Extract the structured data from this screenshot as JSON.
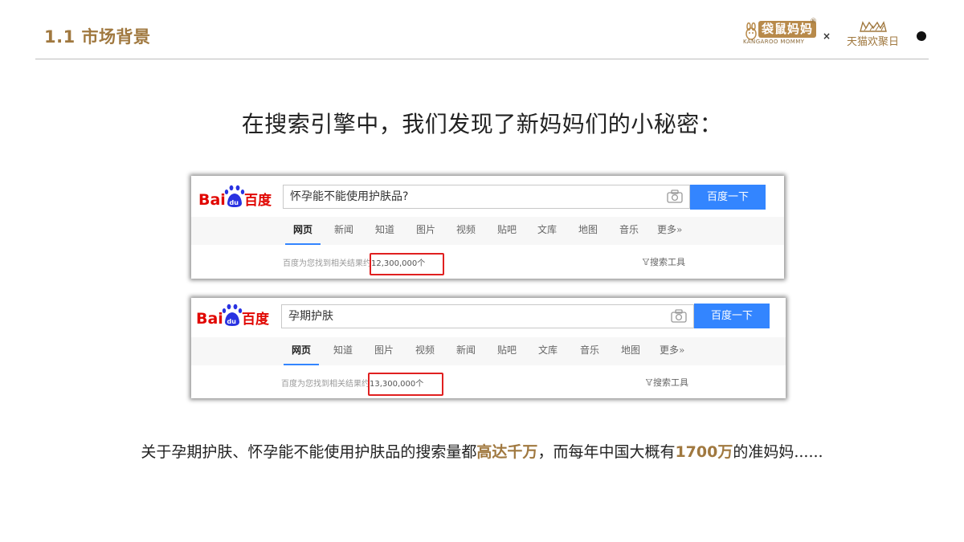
{
  "header": {
    "section_title": "1.1 市场背景",
    "brand_left_cn": "袋鼠妈妈",
    "brand_left_en": "KANGAROO MOMMY",
    "brand_left_reg": "®",
    "separator": "×",
    "brand_right": "天猫欢聚日"
  },
  "headline": "在搜索引擎中，我们发现了新妈妈们的小秘密：",
  "search_1": {
    "query": "怀孕能不能使用护肤品?",
    "button_label": "百度一下",
    "tabs": [
      "网页",
      "新闻",
      "知道",
      "图片",
      "视频",
      "贴吧",
      "文库",
      "地图",
      "音乐",
      "更多»"
    ],
    "active_tab": "网页",
    "result_prefix": "百度为您找到相关结果约",
    "result_count": "12,300,000个",
    "tools_label": "搜索工具"
  },
  "search_2": {
    "query": "孕期护肤",
    "button_label": "百度一下",
    "tabs": [
      "网页",
      "知道",
      "图片",
      "视频",
      "新闻",
      "贴吧",
      "文库",
      "音乐",
      "地图",
      "更多»"
    ],
    "active_tab": "网页",
    "result_prefix": "百度为您找到相关结果约",
    "result_count": "13,300,000个",
    "tools_label": "搜索工具"
  },
  "caption": {
    "part1": "关于孕期护肤、怀孕能不能使用护肤品的搜索量都",
    "emph1": "高达千万",
    "part2": "，而每年中国大概有",
    "emph2": "1700万",
    "part3": "的准妈妈......"
  },
  "colors": {
    "accent_gold": "#a0783f",
    "baidu_blue": "#3385ff",
    "baidu_red": "#e10601",
    "highlight_red": "#e02020"
  }
}
